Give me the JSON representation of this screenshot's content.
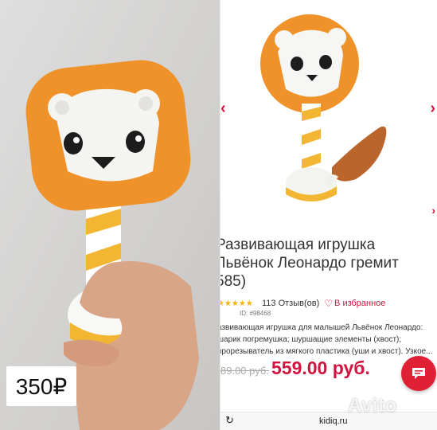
{
  "left_photo": {
    "price": "350₽"
  },
  "product": {
    "title_lines": [
      "Развивающая игрушка",
      "Львёнок Леонардо гремит",
      "585)"
    ],
    "stars": "★★★★★",
    "reviews": "113 Отзыв(ов)",
    "favorite": "В избранное",
    "id": "ID: #98468",
    "description_lines": [
      "азвивающая игрушка для малышей Львёнок Леонардо:",
      "шарик погремушка; шуршащие элементы (хвост);",
      "прорезыватель из мягкого пластика (уши и хвост). Узкое..."
    ],
    "old_price": "89.00 руб.",
    "new_price": "559.00 руб."
  },
  "browser": {
    "url": "kidiq.ru"
  },
  "watermark": "Avito",
  "colors": {
    "accent": "#d3133f",
    "toy_orange": "#f0922a",
    "toy_yellow": "#f2b632",
    "star": "#f4b400"
  },
  "icons": {
    "left_arrow": "chevron-left",
    "right_arrow": "chevron-right",
    "heart": "heart-outline",
    "chat": "chat-bubble",
    "reload": "reload"
  }
}
